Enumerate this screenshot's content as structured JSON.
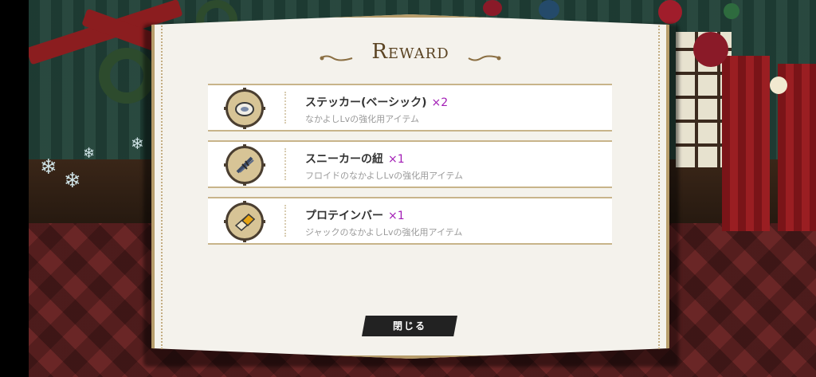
{
  "dialog": {
    "title": "Reward",
    "close_label": "閉じる"
  },
  "rewards": [
    {
      "name": "ステッカー(ベーシック)",
      "qty": "×2",
      "desc": "なかよしLvの強化用アイテム",
      "icon": "sticker-icon"
    },
    {
      "name": "スニーカーの紐",
      "qty": "×1",
      "desc": "フロイドのなかよしLvの強化用アイテム",
      "icon": "shoelace-icon"
    },
    {
      "name": "プロテインバー",
      "qty": "×1",
      "desc": "ジャックのなかよしLvの強化用アイテム",
      "icon": "protein-bar-icon"
    }
  ],
  "colors": {
    "accent_qty": "#a21cb5",
    "panel_border": "#b79d6b",
    "button_bg": "#222222"
  }
}
